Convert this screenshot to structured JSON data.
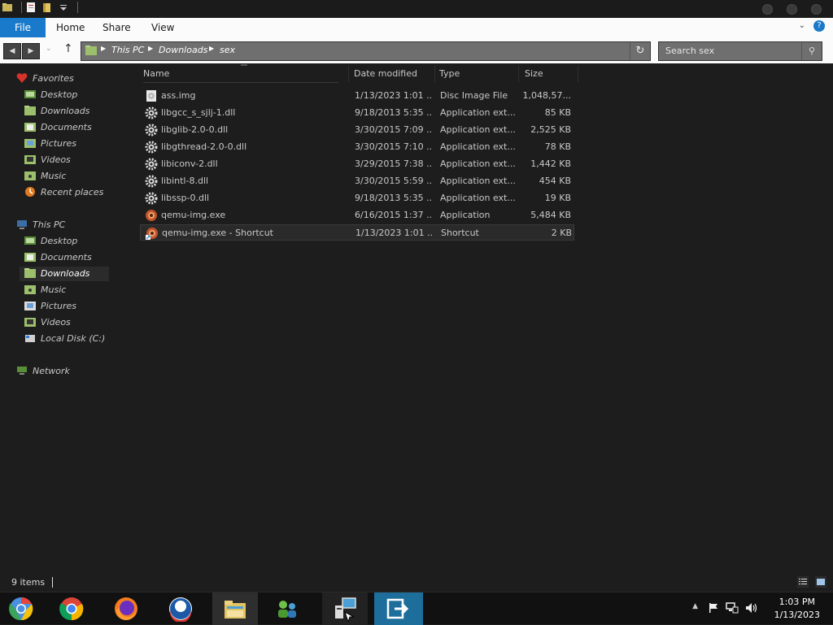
{
  "titlebar": {
    "qat_icons": [
      "folder-icon",
      "properties-icon",
      "new-folder-icon",
      "qat-dropdown-icon"
    ]
  },
  "ribbon": {
    "tabs": [
      "File",
      "Home",
      "Share",
      "View"
    ]
  },
  "address": {
    "segments": [
      "This PC",
      "Downloads",
      "sex"
    ]
  },
  "search": {
    "placeholder": "Search sex"
  },
  "navpane": {
    "favorites_label": "Favorites",
    "favorites": [
      "Desktop",
      "Downloads",
      "Documents",
      "Pictures",
      "Videos",
      "Music",
      "Recent places"
    ],
    "thispc_label": "This PC",
    "thispc": [
      "Desktop",
      "Documents",
      "Downloads",
      "Music",
      "Pictures",
      "Videos",
      "Local Disk (C:)"
    ],
    "network_label": "Network",
    "selected": "Downloads"
  },
  "filelist": {
    "headers": [
      "Name",
      "Date modified",
      "Type",
      "Size"
    ],
    "rows": [
      {
        "name": "ass.img",
        "date": "1/13/2023 1:01 ...",
        "type": "Disc Image File",
        "size": "1,048,57...",
        "icon": "disc-image-icon"
      },
      {
        "name": "libgcc_s_sjlj-1.dll",
        "date": "9/18/2013 5:35 ...",
        "type": "Application ext...",
        "size": "85 KB",
        "icon": "dll-gear-icon"
      },
      {
        "name": "libglib-2.0-0.dll",
        "date": "3/30/2015 7:09 ...",
        "type": "Application ext...",
        "size": "2,525 KB",
        "icon": "dll-gear-icon"
      },
      {
        "name": "libgthread-2.0-0.dll",
        "date": "3/30/2015 7:10 ...",
        "type": "Application ext...",
        "size": "78 KB",
        "icon": "dll-gear-icon"
      },
      {
        "name": "libiconv-2.dll",
        "date": "3/29/2015 7:38 ...",
        "type": "Application ext...",
        "size": "1,442 KB",
        "icon": "dll-gear-icon"
      },
      {
        "name": "libintl-8.dll",
        "date": "3/30/2015 5:59 ...",
        "type": "Application ext...",
        "size": "454 KB",
        "icon": "dll-gear-icon"
      },
      {
        "name": "libssp-0.dll",
        "date": "9/18/2013 5:35 ...",
        "type": "Application ext...",
        "size": "19 KB",
        "icon": "dll-gear-icon"
      },
      {
        "name": "qemu-img.exe",
        "date": "6/16/2015 1:37 ...",
        "type": "Application",
        "size": "5,484 KB",
        "icon": "qemu-app-icon"
      },
      {
        "name": "qemu-img.exe - Shortcut",
        "date": "1/13/2023 1:01 ...",
        "type": "Shortcut",
        "size": "2 KB",
        "icon": "qemu-shortcut-icon"
      }
    ]
  },
  "status": {
    "item_count": "9 items"
  },
  "taskbar": {
    "apps": [
      "chromium-icon",
      "chrome-icon",
      "firefox-icon",
      "obama-logo-icon",
      "file-explorer-icon",
      "network-people-icon",
      "setup-installer-icon",
      "remote-arrow-icon"
    ],
    "time": "1:03 PM",
    "date": "1/13/2023"
  },
  "colors": {
    "accent": "#1979ca",
    "background": "#1d1d1d",
    "text": "#c8c8c8"
  }
}
